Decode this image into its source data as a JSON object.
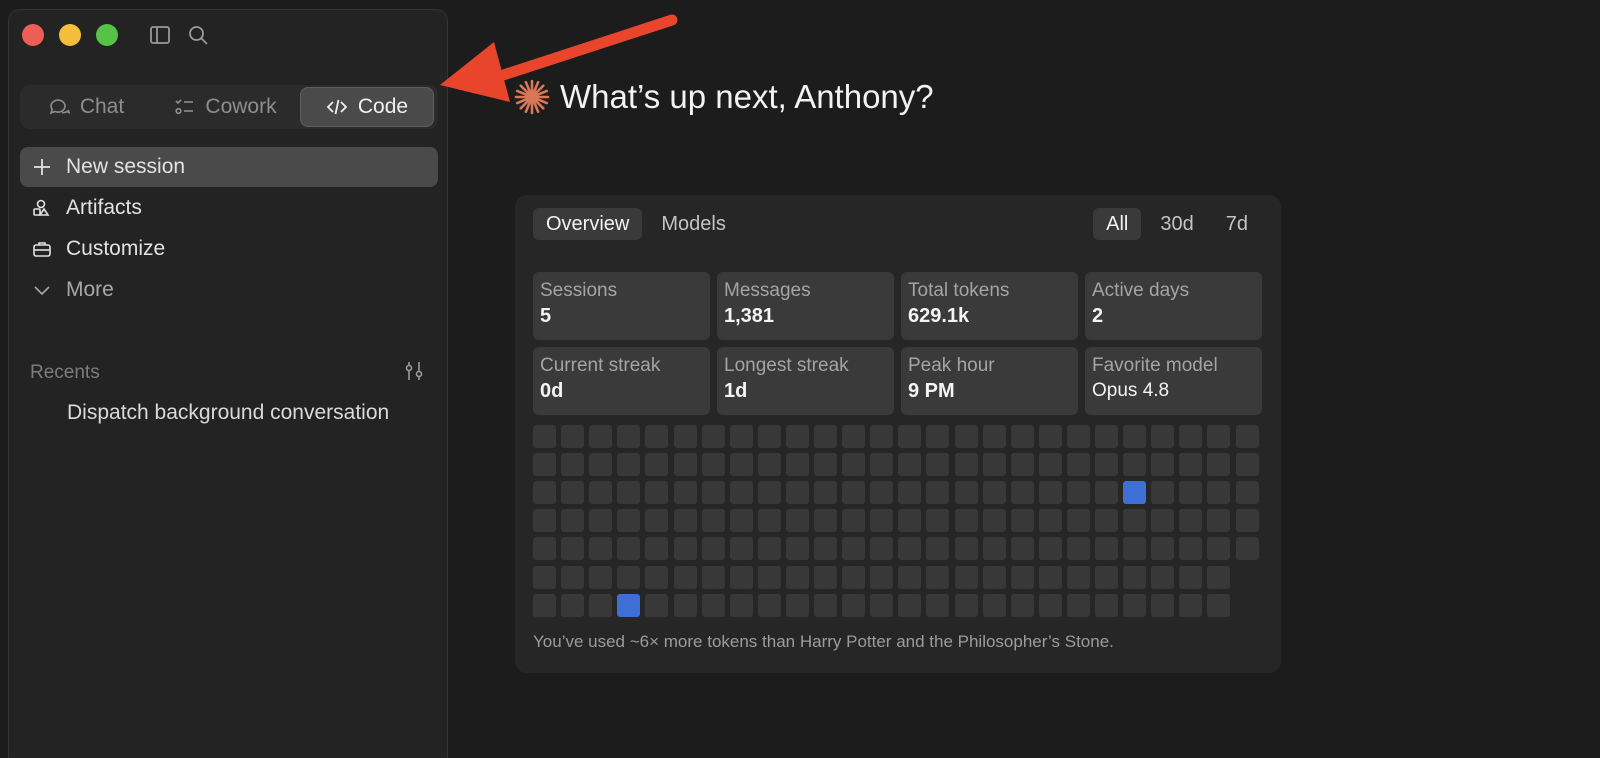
{
  "sidebar": {
    "mode_tabs": [
      {
        "label": "Chat",
        "icon": "chat-bubble-icon",
        "active": false
      },
      {
        "label": "Cowork",
        "icon": "checklist-icon",
        "active": false
      },
      {
        "label": "Code",
        "icon": "code-icon",
        "active": true
      }
    ],
    "nav": {
      "new_session": "New session",
      "artifacts": "Artifacts",
      "customize": "Customize",
      "more": "More"
    },
    "recents_label": "Recents",
    "recents": [
      "Dispatch background conversation"
    ]
  },
  "main": {
    "greeting": "What’s up next, Anthony?"
  },
  "stats_card": {
    "tabs": [
      "Overview",
      "Models"
    ],
    "active_tab": "Overview",
    "ranges": [
      "All",
      "30d",
      "7d"
    ],
    "active_range": "All",
    "stats": [
      {
        "label": "Sessions",
        "value": "5"
      },
      {
        "label": "Messages",
        "value": "1,381"
      },
      {
        "label": "Total tokens",
        "value": "629.1k"
      },
      {
        "label": "Active days",
        "value": "2"
      },
      {
        "label": "Current streak",
        "value": "0d"
      },
      {
        "label": "Longest streak",
        "value": "1d"
      },
      {
        "label": "Peak hour",
        "value": "9 PM"
      },
      {
        "label": "Favorite model",
        "value": "Opus 4.8"
      }
    ],
    "heatmap": {
      "rows": 7,
      "columns": 26,
      "short_rows": [
        5,
        6
      ],
      "short_row_columns": 25,
      "active_cells": [
        {
          "row": 2,
          "column": 21
        },
        {
          "row": 6,
          "column": 3
        }
      ]
    },
    "footnote": "You’ve used ~6× more tokens than Harry Potter and the Philosopher’s Stone."
  },
  "colors": {
    "accent": "#d97757",
    "activity": "#3d6fd6",
    "annotation_arrow": "#e8452c"
  }
}
